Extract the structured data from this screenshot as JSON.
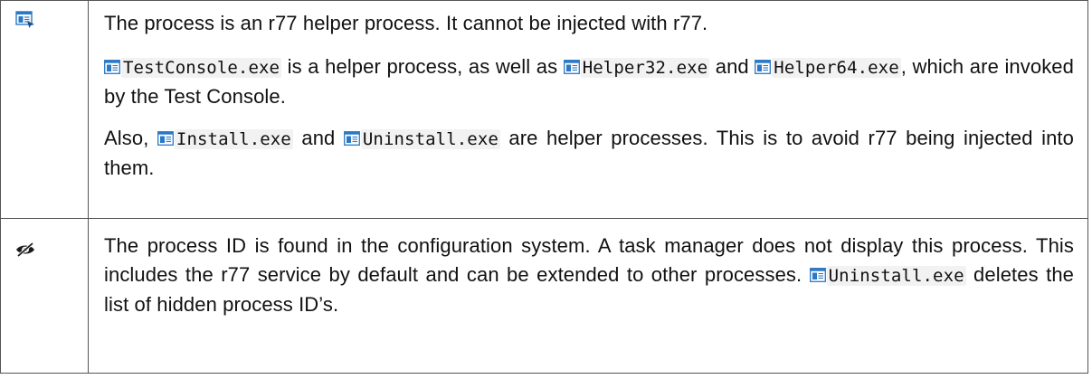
{
  "rows": [
    {
      "icon": "helper-process-icon",
      "paragraphs": [
        {
          "parts": [
            {
              "type": "text",
              "value": "The process is an r77 helper process. It cannot be injected with r77."
            }
          ]
        },
        {
          "parts": [
            {
              "type": "file",
              "value": "TestConsole.exe"
            },
            {
              "type": "text",
              "value": " is a helper process, as well as "
            },
            {
              "type": "file",
              "value": "Helper32.exe"
            },
            {
              "type": "text",
              "value": " and "
            },
            {
              "type": "file",
              "value": "Helper64.exe"
            },
            {
              "type": "text",
              "value": ", which are invoked by the Test Console."
            }
          ]
        },
        {
          "parts": [
            {
              "type": "text",
              "value": "Also, "
            },
            {
              "type": "file",
              "value": "Install.exe"
            },
            {
              "type": "text",
              "value": " and "
            },
            {
              "type": "file",
              "value": "Uninstall.exe"
            },
            {
              "type": "text",
              "value": " are helper processes. This is to avoid r77 being injected into them."
            }
          ]
        }
      ]
    },
    {
      "icon": "hidden-eye-icon",
      "paragraphs": [
        {
          "parts": [
            {
              "type": "text",
              "value": "The process ID is found in the configuration system. A task manager does not display this process. This includes the r77 service by default and can be extended to other processes. "
            },
            {
              "type": "file",
              "value": "Uninstall.exe"
            },
            {
              "type": "text",
              "value": " deletes the list of hidden process ID’s."
            }
          ]
        }
      ]
    }
  ]
}
